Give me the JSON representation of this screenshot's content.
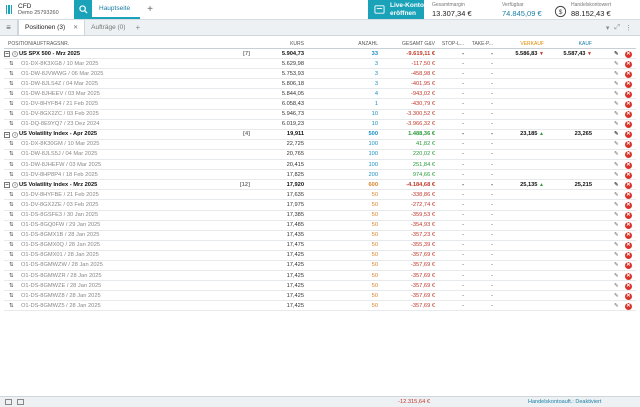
{
  "app": {
    "account_type": "CFD",
    "account_id": "Demo 25793260",
    "main_tab": "Hauptseite",
    "live_button": [
      "Live-Konto",
      "eröffnen"
    ],
    "metrics": {
      "margin_label": "Gesamtmargin",
      "margin_value": "13.307,34 €",
      "available_label": "Verfügbar",
      "available_value": "74.845,09 €",
      "account_value_label": "Handelskontowert",
      "account_value_value": "88.152,43 €"
    }
  },
  "tabs": {
    "positions_label": "Positionen (3)",
    "orders_label": "Aufträge (0)",
    "close_glyph": "✕",
    "add_glyph": "+"
  },
  "table": {
    "headers": {
      "name": "POSITION/AUFTRAGSNR.",
      "kurs": "KURS",
      "anzahl": "ANZAHL",
      "gv": "GESAMT G&V",
      "stop": "STOP-L...",
      "take": "TAKE-P...",
      "verkauf": "VERKAUF",
      "kauf": "KAUF"
    },
    "groups": [
      {
        "name": "US SPX 500 - Mrz 2025",
        "count": "[7]",
        "kurs": "5.904,73",
        "anzahl": "33",
        "gv": "-9.619,11 €",
        "stop": "-",
        "take": "-",
        "verkauf": "5.586,83",
        "kauf": "5.587,43",
        "verkauf_dir": "down",
        "kauf_dir": "down",
        "anz_class": "blue",
        "gv_class": "neg",
        "rows": [
          {
            "name": "O1-DX-8K3XG8 / 10 Mar 2025",
            "kurs": "5.629,98",
            "anzahl": "3",
            "gv": "-117,50 €"
          },
          {
            "name": "O1-DW-8JVWWG / 06 Mar 2025",
            "kurs": "5.753,93",
            "anzahl": "3",
            "gv": "-458,98 €"
          },
          {
            "name": "O1-DW-8JLS4Z / 04 Mar 2025",
            "kurs": "5.806,18",
            "anzahl": "3",
            "gv": "-401,95 €"
          },
          {
            "name": "O1-DW-8JHEEV / 03 Mar 2025",
            "kurs": "5.844,05",
            "anzahl": "4",
            "gv": "-943,02 €"
          },
          {
            "name": "O1-DV-8HYFB4 / 21 Feb 2025",
            "kurs": "6.058,43",
            "anzahl": "1",
            "gv": "-430,79 €"
          },
          {
            "name": "O1-DV-8GX2ZC / 03 Feb 2025",
            "kurs": "5.946,73",
            "anzahl": "10",
            "gv": "-3.300,52 €"
          },
          {
            "name": "O1-DQ-8E9YQ7 / 23 Dez 2024",
            "kurs": "6.019,23",
            "anzahl": "10",
            "gv": "-3.966,32 €"
          }
        ]
      },
      {
        "name": "US Volatility Index - Apr 2025",
        "count": "[4]",
        "kurs": "19,911",
        "anzahl": "500",
        "gv": "1.488,36 €",
        "stop": "-",
        "take": "-",
        "verkauf": "23,185",
        "kauf": "23,265",
        "verkauf_dir": "up",
        "kauf_dir": "",
        "anz_class": "blue",
        "gv_class": "pos-val",
        "rows": [
          {
            "name": "O1-DX-8K30GM / 10 Mar 2025",
            "kurs": "22,725",
            "anzahl": "100",
            "gv": "41,82 €"
          },
          {
            "name": "O1-DW-8JLS5J / 04 Mar 2025",
            "kurs": "20,765",
            "anzahl": "100",
            "gv": "220,02 €"
          },
          {
            "name": "O1-DW-8JHEFW / 03 Mar 2025",
            "kurs": "20,415",
            "anzahl": "100",
            "gv": "251,84 €"
          },
          {
            "name": "O1-DV-8HP8P4 / 18 Feb 2025",
            "kurs": "17,825",
            "anzahl": "200",
            "gv": "974,66 €"
          }
        ]
      },
      {
        "name": "US Volatility Index - Mrz 2025",
        "count": "[12]",
        "kurs": "17,920",
        "anzahl": "600",
        "gv": "-4.184,68 €",
        "stop": "-",
        "take": "-",
        "verkauf": "25,135",
        "kauf": "25,215",
        "verkauf_dir": "up",
        "kauf_dir": "",
        "anz_class": "orange",
        "gv_class": "neg",
        "rows": [
          {
            "name": "O1-DV-8HYFBE / 21 Feb 2025",
            "kurs": "17,635",
            "anzahl": "50",
            "gv": "-338,86 €"
          },
          {
            "name": "O1-DV-8GX2ZE / 03 Feb 2025",
            "kurs": "17,975",
            "anzahl": "50",
            "gv": "-272,74 €"
          },
          {
            "name": "O1-DS-8GSFE3 / 30 Jan 2025",
            "kurs": "17,385",
            "anzahl": "50",
            "gv": "-359,53 €"
          },
          {
            "name": "O1-DS-8GQ0FW / 29 Jan 2025",
            "kurs": "17,485",
            "anzahl": "50",
            "gv": "-354,93 €"
          },
          {
            "name": "O1-DS-8GMX1B / 28 Jan 2025",
            "kurs": "17,435",
            "anzahl": "50",
            "gv": "-357,23 €"
          },
          {
            "name": "O1-DS-8GMX0Q / 28 Jan 2025",
            "kurs": "17,475",
            "anzahl": "50",
            "gv": "-355,39 €"
          },
          {
            "name": "O1-DS-8GMX01 / 28 Jan 2025",
            "kurs": "17,425",
            "anzahl": "50",
            "gv": "-357,69 €"
          },
          {
            "name": "O1-DS-8GMWZW / 28 Jan 2025",
            "kurs": "17,425",
            "anzahl": "50",
            "gv": "-357,69 €"
          },
          {
            "name": "O1-DS-8GMWZR / 28 Jan 2025",
            "kurs": "17,425",
            "anzahl": "50",
            "gv": "-357,69 €"
          },
          {
            "name": "O1-DS-8GMWZE / 28 Jan 2025",
            "kurs": "17,425",
            "anzahl": "50",
            "gv": "-357,69 €"
          },
          {
            "name": "O1-DS-8GMWZ8 / 28 Jan 2025",
            "kurs": "17,425",
            "anzahl": "50",
            "gv": "-357,69 €"
          },
          {
            "name": "O1-DS-8GMWZ5 / 28 Jan 2025",
            "kurs": "17,425",
            "anzahl": "50",
            "gv": "-357,69 €"
          }
        ]
      }
    ],
    "dash": "-"
  },
  "footer": {
    "total": "-12.315,64 €",
    "status": "Handelskontoauft.: Deaktiviert"
  },
  "colors": {
    "accent": "#1aa3b8",
    "negative": "#c0392b",
    "positive": "#2a9c3a",
    "orange": "#d9822b"
  },
  "icons": [
    "bars-logo-icon",
    "search-icon",
    "live-account-icon",
    "clock-icon",
    "menu-icon",
    "swap-arrows-icon",
    "edit-pencil-icon",
    "delete-icon"
  ]
}
